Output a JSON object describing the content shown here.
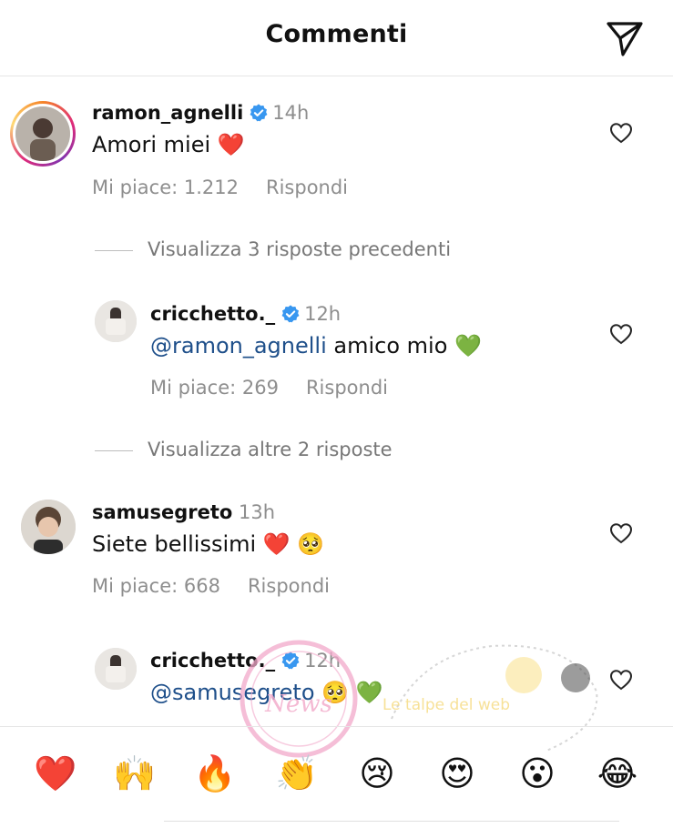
{
  "header": {
    "title": "Commenti",
    "share_icon": "paper-plane-icon"
  },
  "comments": [
    {
      "username": "ramon_agnelli",
      "verified": true,
      "time": "14h",
      "text": "Amori miei",
      "emoji": "❤️",
      "likes": "Mi piace: 1.212",
      "reply": "Rispondi",
      "story_ring": true
    },
    {
      "username": "cricchetto._",
      "verified": true,
      "time": "12h",
      "mention": "@ramon_agnelli",
      "text": " amico mio",
      "emoji": "💚",
      "likes": "Mi piace: 269",
      "reply": "Rispondi"
    },
    {
      "username": "samusegreto",
      "verified": false,
      "time": "13h",
      "text": "Siete bellissimi",
      "emoji": "❤️ 🥺",
      "likes": "Mi piace: 668",
      "reply": "Rispondi"
    },
    {
      "username": "cricchetto._",
      "verified": true,
      "time": "12h",
      "mention": "@samusegreto",
      "emoji": "🥺 💚"
    }
  ],
  "view_more": [
    "Visualizza 3 risposte precedenti",
    "Visualizza altre 2 risposte"
  ],
  "reactions": [
    "❤️",
    "🙌",
    "🔥",
    "👏",
    "😢",
    "😍",
    "😮",
    "😂"
  ],
  "watermark": {
    "text_a": "News",
    "text_b": "Le talpe del web"
  }
}
